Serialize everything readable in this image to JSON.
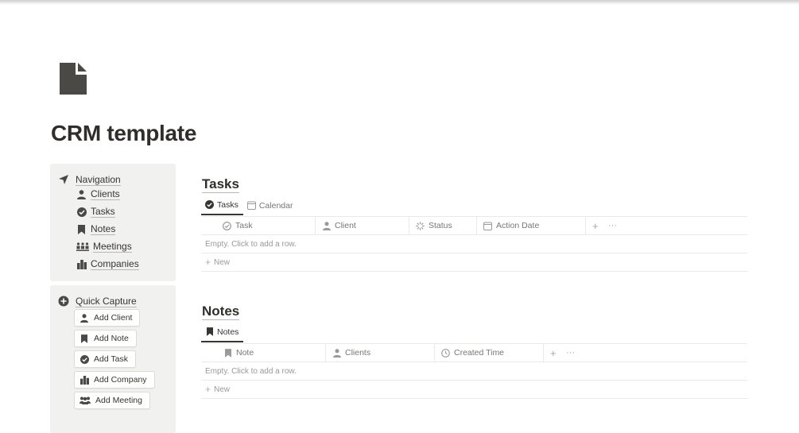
{
  "page": {
    "title": "CRM template",
    "icon": "page-doc-icon"
  },
  "navigation": {
    "header": "Navigation",
    "header_icon": "location-arrow-icon",
    "items": [
      {
        "label": "Clients",
        "icon": "person-icon"
      },
      {
        "label": "Tasks",
        "icon": "check-circle-icon"
      },
      {
        "label": "Notes",
        "icon": "bookmark-icon"
      },
      {
        "label": "Meetings",
        "icon": "people-group-icon"
      },
      {
        "label": "Companies",
        "icon": "buildings-icon"
      }
    ]
  },
  "quick_capture": {
    "header": "Quick Capture",
    "header_icon": "plus-circle-icon",
    "buttons": [
      {
        "label": "Add Client",
        "icon": "person-icon"
      },
      {
        "label": "Add Note",
        "icon": "bookmark-icon"
      },
      {
        "label": "Add Task",
        "icon": "check-circle-icon"
      },
      {
        "label": "Add Company",
        "icon": "buildings-icon"
      },
      {
        "label": "Add Meeting",
        "icon": "people-group-icon"
      }
    ]
  },
  "tasks_db": {
    "title": "Tasks",
    "tabs": [
      {
        "label": "Tasks",
        "icon": "check-circle-icon",
        "active": true
      },
      {
        "label": "Calendar",
        "icon": "calendar-icon",
        "active": false
      }
    ],
    "columns": [
      {
        "label": "Task",
        "icon": "check-circle-icon"
      },
      {
        "label": "Client",
        "icon": "person-icon"
      },
      {
        "label": "Status",
        "icon": "status-spinner-icon"
      },
      {
        "label": "Action Date",
        "icon": "calendar-icon"
      }
    ],
    "empty_text": "Empty. Click to add a row.",
    "new_label": "New"
  },
  "notes_db": {
    "title": "Notes",
    "tabs": [
      {
        "label": "Notes",
        "icon": "bookmark-icon",
        "active": true
      }
    ],
    "columns": [
      {
        "label": "Note",
        "icon": "bookmark-icon"
      },
      {
        "label": "Clients",
        "icon": "person-icon"
      },
      {
        "label": "Created Time",
        "icon": "clock-icon"
      }
    ],
    "empty_text": "Empty. Click to add a row.",
    "new_label": "New"
  },
  "table_tools": {
    "add_column": "+",
    "more": "···"
  },
  "colors": {
    "text": "#37352f",
    "muted": "#787774",
    "callout_bg": "#f1f1ef",
    "icon_dark": "#4a4945"
  }
}
